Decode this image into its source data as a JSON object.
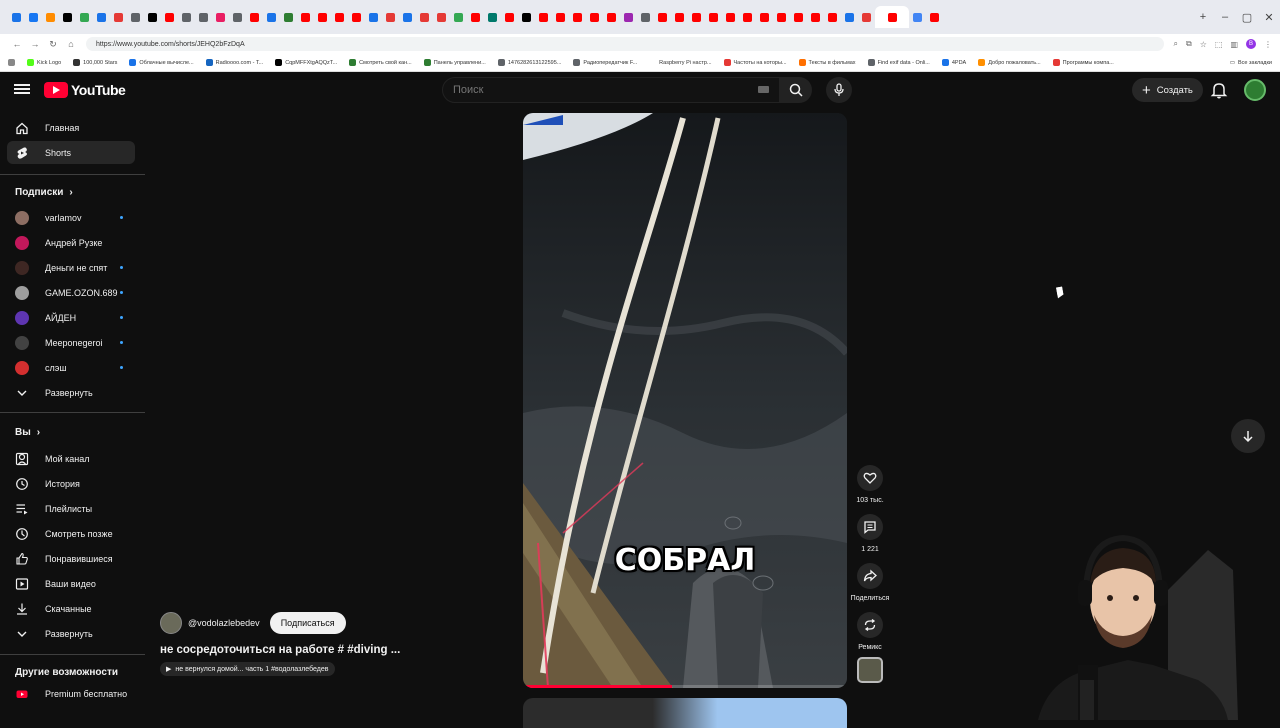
{
  "browser": {
    "url": "https://www.youtube.com/shorts/JEHQ2bFzDqA",
    "tab_favicons": [
      "#1a73e8",
      "#1877f2",
      "#ff8c00",
      "#000000",
      "#34a853",
      "#1a73e8",
      "#e53935",
      "#5f6368",
      "#000000",
      "#ff0000",
      "#5f6368",
      "#5f6368",
      "#e91e63",
      "#5f6368",
      "#ff0000",
      "#1a73e8",
      "#2e7d32",
      "#ff0000",
      "#ff0000",
      "#ff0000",
      "#ff0000",
      "#1a73e8",
      "#e53935",
      "#1a73e8",
      "#e53935",
      "#e53935",
      "#34a853",
      "#ff0000",
      "#00796b",
      "#ff0000",
      "#000000",
      "#ff0000",
      "#ff0000",
      "#ff0000",
      "#ff0000",
      "#ff0000",
      "#9c27b0",
      "#5f6368",
      "#ff0000",
      "#ff0000",
      "#ff0000",
      "#ff0000",
      "#ff0000",
      "#ff0000",
      "#ff0000",
      "#ff0000",
      "#ff0000",
      "#ff0000",
      "#ff0000",
      "#1a73e8",
      "#e53935",
      "#ff0000",
      "#4285f4",
      "#ff0000"
    ],
    "bookmarks": [
      {
        "label": "Kick Logo",
        "color": "#53fc18"
      },
      {
        "label": "100,000 Stars",
        "color": "#333333"
      },
      {
        "label": "Облачные вычисле...",
        "color": "#1a73e8"
      },
      {
        "label": "Radioooo.com - T...",
        "color": "#1565c0"
      },
      {
        "label": "CqpMFFXtgAQQzT...",
        "color": "#000000"
      },
      {
        "label": "Смотреть свой кан...",
        "color": "#2e7d32"
      },
      {
        "label": "Панель управлени...",
        "color": "#2e7d32"
      },
      {
        "label": "1476282613122595...",
        "color": "#5f6368"
      },
      {
        "label": "Радиопередатчик F...",
        "color": "#5f6368"
      },
      {
        "label": "Raspberry Pi настр...",
        "color": "#ffffff"
      },
      {
        "label": "Частоты на которы...",
        "color": "#e53935"
      },
      {
        "label": "Тексты в фильмах",
        "color": "#ff6f00"
      },
      {
        "label": "Find exif data - Onli...",
        "color": "#5f6368"
      },
      {
        "label": "4PDA",
        "color": "#1a73e8"
      },
      {
        "label": "Добро пожаловать...",
        "color": "#ff8f00"
      },
      {
        "label": "Программы компа...",
        "color": "#e53935"
      }
    ],
    "bookmarks_all": "Все закладки"
  },
  "header": {
    "logo_text": "YouTube",
    "search_placeholder": "Поиск",
    "create_label": "Создать"
  },
  "sidebar": {
    "main": [
      {
        "label": "Главная",
        "icon": "home-icon"
      },
      {
        "label": "Shorts",
        "icon": "shorts-icon"
      }
    ],
    "subscriptions_title": "Подписки",
    "subscriptions": [
      {
        "label": "varlamov",
        "color": "#8d6e63",
        "new": true
      },
      {
        "label": "Андрей Рузке",
        "color": "#c2185b",
        "new": false
      },
      {
        "label": "Деньги не спят",
        "color": "#3e2723",
        "new": true
      },
      {
        "label": "GAME.OZON.689",
        "color": "#9e9e9e",
        "new": true
      },
      {
        "label": "АЙДЕН",
        "color": "#5e35b1",
        "new": true
      },
      {
        "label": "Meeponegeroi",
        "color": "#424242",
        "new": true
      },
      {
        "label": "слэш",
        "color": "#d32f2f",
        "new": true
      }
    ],
    "expand_label": "Развернуть",
    "you_title": "Вы",
    "you_items": [
      {
        "label": "Мой канал",
        "icon": "channel-icon"
      },
      {
        "label": "История",
        "icon": "history-icon"
      },
      {
        "label": "Плейлисты",
        "icon": "playlists-icon"
      },
      {
        "label": "Смотреть позже",
        "icon": "watch-later-icon"
      },
      {
        "label": "Понравившиеся",
        "icon": "like-icon"
      },
      {
        "label": "Ваши видео",
        "icon": "your-videos-icon"
      },
      {
        "label": "Скачанные",
        "icon": "download-icon"
      },
      {
        "label": "Развернуть",
        "icon": "chevron-down-icon"
      }
    ],
    "more_title": "Другие возможности",
    "premium_label": "Premium бесплатно"
  },
  "video": {
    "caption": "СОБРАЛ",
    "progress": 0.46,
    "channel": "@vodolazlebedev",
    "subscribe_label": "Подписаться",
    "title": "не сосредоточиться на работе # #diving ...",
    "playlist": "не вернулся домой... часть 1 #водолазлебедев"
  },
  "actions": {
    "likes": "103 тыс.",
    "comments": "1 221",
    "share": "Поделиться",
    "remix": "Ремикс"
  }
}
